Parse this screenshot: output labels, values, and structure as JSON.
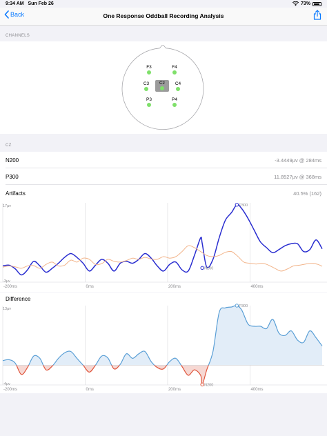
{
  "status": {
    "time": "9:34 AM",
    "date": "Sun Feb 26",
    "battery": "73%"
  },
  "nav": {
    "back_label": "Back",
    "title": "One Response Oddball Recording Analysis"
  },
  "channels": {
    "section_label": "CHANNELS",
    "electrodes": [
      "F3",
      "F4",
      "C3",
      "Cz",
      "C4",
      "P3",
      "P4"
    ],
    "selected": "Cz"
  },
  "cz_section": {
    "label": "CZ"
  },
  "metrics": [
    {
      "label": "N200",
      "value": "-3.4449µv @ 284ms"
    },
    {
      "label": "P300",
      "value": "11.8527µv @ 368ms"
    },
    {
      "label": "Artifacts",
      "value": "40.5% (162)"
    }
  ],
  "colors": {
    "accent": "#0a7aff",
    "main_line": "#2a2ed0",
    "baseline_line": "#f2b48a",
    "diff_line": "#5a9fd6",
    "diff_fill": "#e2edf8",
    "neg_fill": "#f6d8d3",
    "neg_line": "#e0553c",
    "electrode": "#7fe06a"
  },
  "chart_data": [
    {
      "type": "line",
      "title": "",
      "xlabel": "",
      "ylabel": "",
      "top_label": "17µv",
      "bottom_label": "-3µv",
      "ylim": [
        -3,
        17
      ],
      "xlim": [
        -200,
        580
      ],
      "x_ticks": [
        "-200ms",
        "0ms",
        "200ms",
        "400ms"
      ],
      "x_tick_values": [
        -200,
        0,
        200,
        400
      ],
      "series": [
        {
          "x": [
            -200,
            -185,
            -170,
            -155,
            -140,
            -125,
            -110,
            -95,
            -80,
            -65,
            -50,
            -35,
            -20,
            -5,
            10,
            25,
            40,
            55,
            70,
            85,
            100,
            115,
            130,
            145,
            160,
            175,
            190,
            205,
            220,
            235,
            250,
            265,
            280,
            284,
            295,
            310,
            325,
            340,
            355,
            368,
            380,
            395,
            410,
            425,
            440,
            455,
            470,
            485,
            500,
            515,
            530,
            545,
            560,
            575
          ],
          "y": [
            0.8,
            1,
            0.1,
            -1.5,
            -0.2,
            2,
            0.8,
            -0.8,
            0.2,
            1.5,
            3,
            4,
            3,
            1.5,
            -0.5,
            1,
            2.5,
            1.5,
            -0.5,
            1.5,
            2,
            1.5,
            2.5,
            4,
            2.8,
            0.8,
            -0.5,
            1.2,
            1.8,
            -0.2,
            -0.5,
            3.5,
            8,
            6.5,
            0.5,
            2.5,
            8,
            12.5,
            14.5,
            16.5,
            15.5,
            13,
            10,
            7,
            5.5,
            4.2,
            5,
            6,
            6.5,
            6.5,
            4.5,
            5,
            7.5,
            5.2
          ],
          "markers": [
            {
              "x": 284,
              "y": 0.3,
              "label": "N200"
            },
            {
              "x": 368,
              "y": 16.5,
              "label": "P300"
            }
          ]
        },
        {
          "x": [
            -200,
            -185,
            -170,
            -155,
            -140,
            -125,
            -110,
            -95,
            -80,
            -65,
            -50,
            -35,
            -20,
            -5,
            10,
            25,
            40,
            55,
            70,
            85,
            100,
            115,
            130,
            145,
            160,
            175,
            190,
            205,
            220,
            235,
            250,
            265,
            280,
            295,
            310,
            325,
            340,
            355,
            370,
            385,
            400,
            415,
            430,
            445,
            460,
            475,
            490,
            505,
            520,
            535,
            550,
            565,
            575
          ],
          "y": [
            0.5,
            0.8,
            0.6,
            0.2,
            0.8,
            0.9,
            0.2,
            1.2,
            1.8,
            0.8,
            1,
            2.3,
            1.8,
            2.8,
            2.5,
            1.2,
            1.4,
            2.5,
            2,
            1.8,
            2.2,
            2.8,
            2.5,
            3,
            2.6,
            2.5,
            3.2,
            2.8,
            3.2,
            4.5,
            6,
            5.5,
            4.5,
            3.5,
            3.2,
            3.5,
            4.3,
            4.5,
            3.3,
            1.8,
            1.5,
            1.3,
            1.5,
            1,
            0.2,
            -0.5,
            0,
            0.8,
            1,
            1.3,
            1.5,
            1.2,
            0.7
          ]
        }
      ]
    },
    {
      "type": "area",
      "title": "Difference",
      "xlabel": "",
      "ylabel": "",
      "top_label": "13µv",
      "bottom_label": "-4µv",
      "ylim": [
        -4,
        13
      ],
      "xlim": [
        -200,
        580
      ],
      "x_ticks": [
        "-200ms",
        "0ms",
        "200ms",
        "400ms"
      ],
      "x_tick_values": [
        -200,
        0,
        200,
        400
      ],
      "series": [
        {
          "x": [
            -200,
            -185,
            -170,
            -155,
            -140,
            -125,
            -110,
            -95,
            -80,
            -65,
            -50,
            -35,
            -20,
            -5,
            10,
            25,
            40,
            55,
            70,
            85,
            100,
            115,
            130,
            145,
            160,
            175,
            190,
            205,
            220,
            235,
            250,
            265,
            280,
            284,
            295,
            310,
            325,
            340,
            355,
            368,
            380,
            395,
            410,
            425,
            440,
            455,
            470,
            485,
            500,
            515,
            530,
            545,
            560,
            575
          ],
          "y": [
            1,
            1.2,
            0.5,
            -2,
            -0.5,
            2,
            1.5,
            -1,
            -0.2,
            1.5,
            2.7,
            3,
            1.5,
            0,
            -1.5,
            0,
            2,
            1.6,
            -0.8,
            0.2,
            2.5,
            1.5,
            2.5,
            3,
            0.8,
            -0.5,
            -0.8,
            0.8,
            1.5,
            -0.3,
            -2.2,
            -1,
            -2.2,
            -4.2,
            -1,
            3,
            11.5,
            12.5,
            12.7,
            13,
            12,
            9,
            8.5,
            8.5,
            8,
            10,
            7,
            6.5,
            7.5,
            5.5,
            5,
            7.5,
            6,
            4.2
          ],
          "markers": [
            {
              "x": 284,
              "y": -4.2,
              "label": "N200"
            },
            {
              "x": 368,
              "y": 13,
              "label": "P300"
            }
          ]
        }
      ]
    }
  ]
}
